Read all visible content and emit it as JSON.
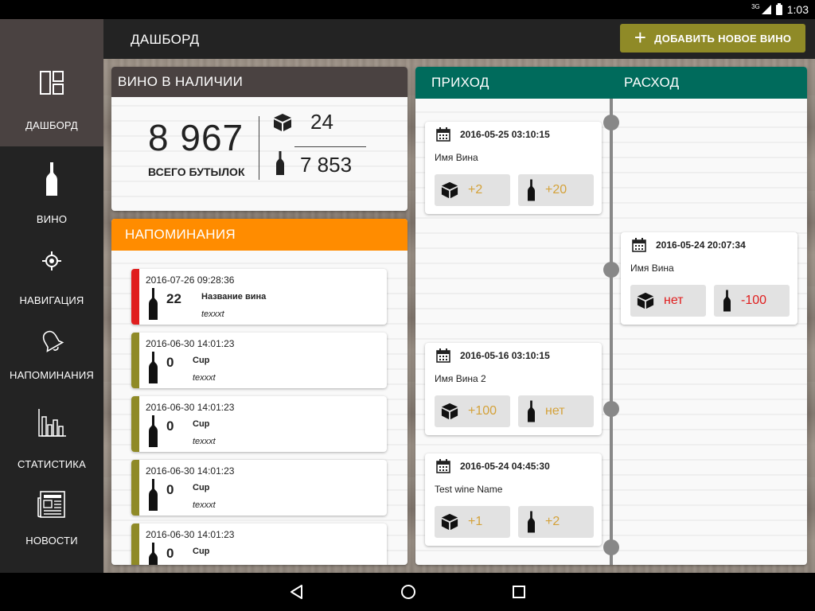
{
  "status_bar": {
    "network": "3G",
    "time": "1:03"
  },
  "sidebar": {
    "items": [
      {
        "label": "ДАШБОРД",
        "icon": "dashboard-icon",
        "active": true
      },
      {
        "label": "ВИНО",
        "icon": "wine-bottle-icon",
        "active": false
      },
      {
        "label": "НАВИГАЦИЯ",
        "icon": "crosshair-icon",
        "active": false
      },
      {
        "label": "НАПОМИНАНИЯ",
        "icon": "bell-icon",
        "active": false
      },
      {
        "label": "СТАТИСТИКА",
        "icon": "bar-chart-icon",
        "active": false
      },
      {
        "label": "НОВОСТИ",
        "icon": "newspaper-icon",
        "active": false
      }
    ]
  },
  "topbar": {
    "title": "ДАШБОРД",
    "add_button": "ДОБАВИТЬ НОВОЕ ВИНО"
  },
  "stock": {
    "header": "ВИНО В НАЛИЧИИ",
    "total": "8 967",
    "total_label": "ВСЕГО БУТЫЛОК",
    "boxes": "24",
    "bottles": "7 853"
  },
  "reminders": {
    "header": "НАПОМИНАНИЯ",
    "items": [
      {
        "date": "2016-07-26 09:28:36",
        "qty": "22",
        "name": "Название вина",
        "note": "texxxt",
        "accent": "#e01e1e"
      },
      {
        "date": "2016-06-30 14:01:23",
        "qty": "0",
        "name": "Cup",
        "note": "texxxt",
        "accent": "#8f8a27"
      },
      {
        "date": "2016-06-30 14:01:23",
        "qty": "0",
        "name": "Cup",
        "note": "texxxt",
        "accent": "#8f8a27"
      },
      {
        "date": "2016-06-30 14:01:23",
        "qty": "0",
        "name": "Cup",
        "note": "texxxt",
        "accent": "#8f8a27"
      },
      {
        "date": "2016-06-30 14:01:23",
        "qty": "0",
        "name": "Cup",
        "note": "",
        "accent": "#8f8a27"
      }
    ]
  },
  "timeline": {
    "income_label": "ПРИХОД",
    "expense_label": "РАСХОД",
    "entries": [
      {
        "side": "in",
        "date": "2016-05-25 03:10:15",
        "name": "Имя Вина",
        "boxes": "+2",
        "bottles": "+20"
      },
      {
        "side": "out",
        "date": "2016-05-24 20:07:34",
        "name": "Имя Вина",
        "boxes": "нет",
        "bottles": "-100"
      },
      {
        "side": "in",
        "date": "2016-05-16 03:10:15",
        "name": "Имя Вина 2",
        "boxes": "+100",
        "bottles": "нет"
      },
      {
        "side": "in",
        "date": "2016-05-24 04:45:30",
        "name": "Test wine Name",
        "boxes": "+1",
        "bottles": "+2"
      }
    ]
  },
  "colors": {
    "brand_olive": "#8f8a27",
    "stock_header": "#4a4241",
    "reminders_header": "#ff8c00",
    "timeline_header": "#006b5c",
    "income_value": "#d4a23a",
    "expense_value": "#e01e1e"
  }
}
